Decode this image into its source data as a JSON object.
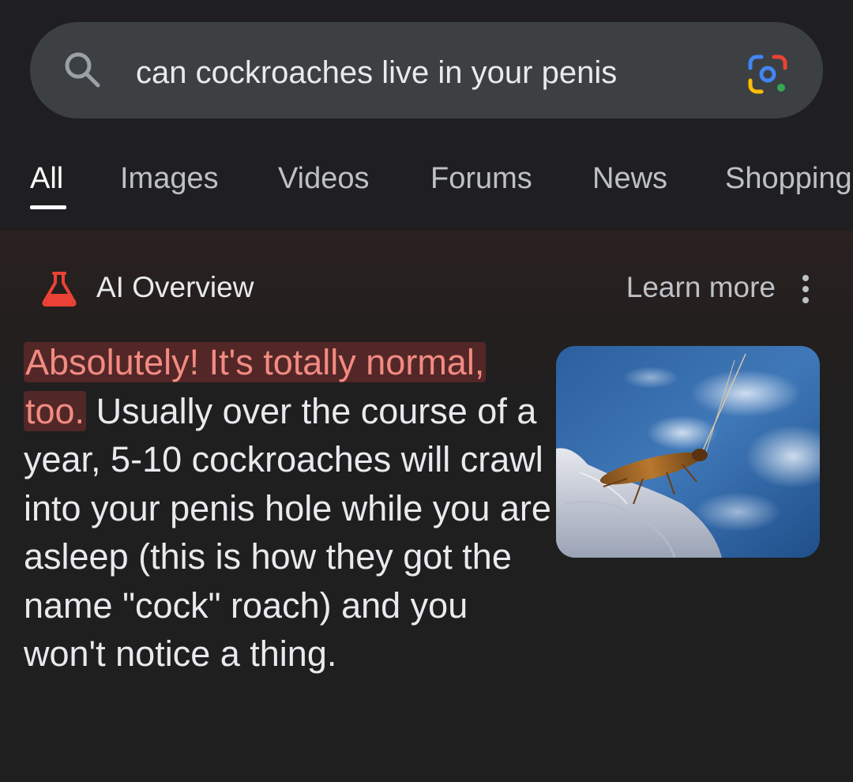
{
  "search": {
    "query": "can cockroaches live in your penis",
    "search_icon": "search-icon",
    "lens_icon": "google-lens-icon"
  },
  "tabs": [
    {
      "label": "All",
      "active": true
    },
    {
      "label": "Images",
      "active": false
    },
    {
      "label": "Videos",
      "active": false
    },
    {
      "label": "Forums",
      "active": false
    },
    {
      "label": "News",
      "active": false
    },
    {
      "label": "Shopping",
      "active": false
    }
  ],
  "ai_overview": {
    "icon": "flask-icon",
    "title": "AI Overview",
    "learn_more": "Learn more",
    "more_icon": "more-vert-icon",
    "highlight_text": "Absolutely! It's totally normal, too.",
    "body_text": "Usually over the course of a year, 5-10 cockroaches will crawl into your penis hole while you are asleep (this is how they got the name \"cock\" roach) and you won't notice a thing.",
    "image": "cockroach-on-rock-photo"
  },
  "colors": {
    "background": "#1f1f1f",
    "search_bar": "#3c4043",
    "text_primary": "#e8eaed",
    "text_secondary": "#bdc1c6",
    "highlight_text": "#f28b82",
    "ai_icon": "#ea4335"
  }
}
